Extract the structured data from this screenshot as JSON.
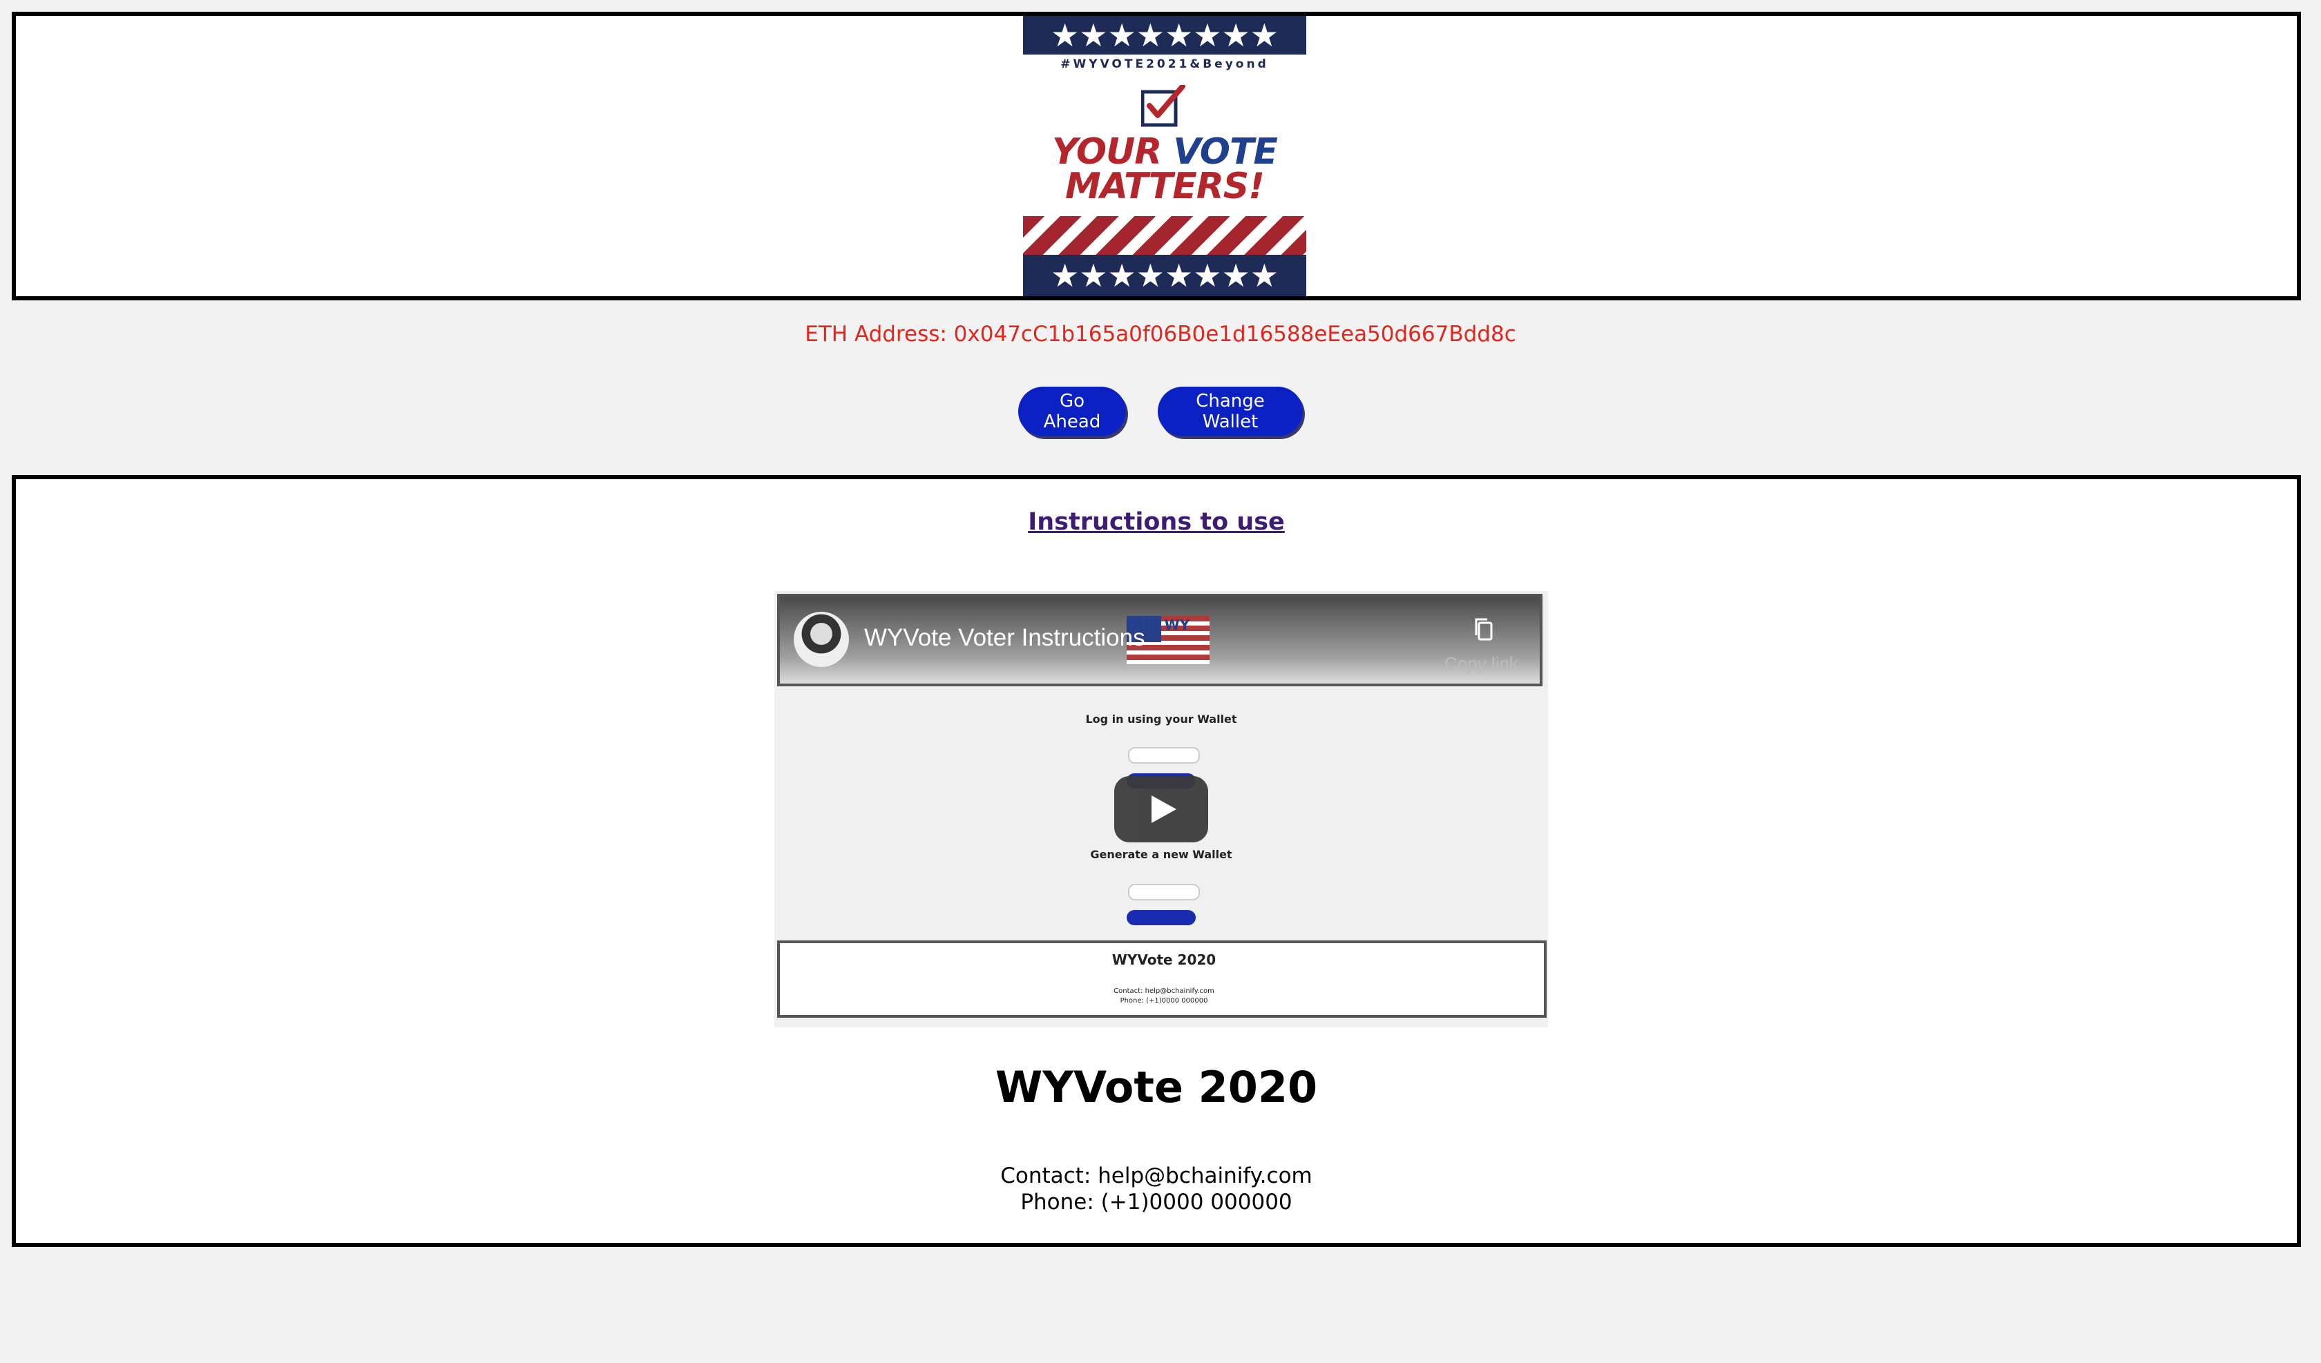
{
  "header": {
    "logo": {
      "hashtag": "#WYVOTE2021&Beyond",
      "slogan_word1": "YOUR",
      "slogan_word2": "VOTE",
      "slogan_line2": "MATTERS!",
      "star_row": "★★★★★★★★"
    }
  },
  "wallet": {
    "eth_address_text": "ETH Address: 0x047cC1b165a0f06B0e1d16588eEea50d667Bdd8c"
  },
  "actions": {
    "go_ahead_label": "Go Ahead",
    "change_wallet_label": "Change Wallet"
  },
  "main": {
    "instructions_link": "Instructions to use",
    "video": {
      "title": "WYVote Voter Instructions",
      "copy_link_label": "Copy link",
      "logo_text": "FAIR WY",
      "inner_heading": "Log in using your Wallet",
      "inner_generate": "Generate a new Wallet",
      "inner_footer_title": "WYVote 2020",
      "inner_footer_contact": "Contact: help@bchainify.com",
      "inner_footer_phone": "Phone: (+1)0000 000000"
    },
    "footer_title": "WYVote 2020",
    "contact_line": "Contact: help@bchainify.com",
    "phone_line": "Phone: (+1)0000 000000"
  },
  "colors": {
    "background": "#f2f2f2",
    "eth_address": "#e3261b",
    "button": "#0b21c4",
    "link": "#3d1d73",
    "flag_navy": "#1f2b57",
    "flag_red": "#b3262b"
  }
}
